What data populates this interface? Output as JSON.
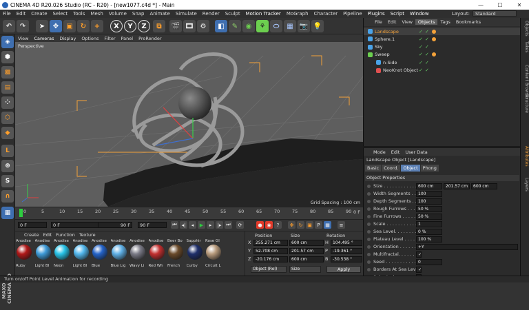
{
  "window": {
    "title": "CINEMA 4D R20.026 Studio (RC - R20) - [new1077.c4d *] - Main"
  },
  "menubar": [
    "File",
    "Edit",
    "Create",
    "Select",
    "Tools",
    "Mesh",
    "Volume",
    "Snap",
    "Animate",
    "Simulate",
    "Render",
    "Sculpt",
    "Motion Tracker",
    "MoGraph",
    "Character",
    "Pipeline",
    "Plugins",
    "Script",
    "Window"
  ],
  "layout": {
    "label": "Layout:",
    "value": "Standard"
  },
  "toolbar": {
    "axes": [
      "X",
      "Y",
      "Z"
    ]
  },
  "viewport": {
    "menu": [
      "View",
      "Cameras",
      "Display",
      "Options",
      "Filter",
      "Panel",
      "ProRender"
    ],
    "camera": "Perspective",
    "grid_spacing": "Grid Spacing : 100 cm"
  },
  "timeline": {
    "ticks": [
      "0",
      "5",
      "10",
      "15",
      "20",
      "25",
      "30",
      "35",
      "40",
      "45",
      "50",
      "55",
      "60",
      "65",
      "70",
      "75",
      "80",
      "85",
      "90"
    ],
    "frame_badge": "0 F"
  },
  "transport": {
    "start": "0 F",
    "current": "0 F",
    "end": "90 F",
    "end2": "90 F"
  },
  "materials": {
    "menu": [
      "Create",
      "Edit",
      "Function",
      "Texture"
    ],
    "items": [
      {
        "top": "Anodise",
        "bottom": "Ruby",
        "color": "#b01818"
      },
      {
        "top": "Anodise",
        "bottom": "Light Bl",
        "color": "#3f9bd8"
      },
      {
        "top": "Anodise",
        "bottom": "Neon",
        "color": "#28c3e8"
      },
      {
        "top": "Anodise",
        "bottom": "Light Bl",
        "color": "#53b8ee"
      },
      {
        "top": "Anodise",
        "bottom": "Blue",
        "color": "#2463c8"
      },
      {
        "top": "Anodise",
        "bottom": "Blue Lig",
        "color": "#5fb0e6"
      },
      {
        "top": "Anodise",
        "bottom": "Wavy Li",
        "color": "#7a7a86"
      },
      {
        "top": "Anodise",
        "bottom": "Red Wh",
        "color": "#c22f2f"
      },
      {
        "top": "Beer Bo",
        "bottom": "French",
        "color": "#6a4a2a"
      },
      {
        "top": "Sapphir",
        "bottom": "Curby",
        "color": "#1f2f6a"
      },
      {
        "top": "Rose Gl",
        "bottom": "Circuit L",
        "color": "#b79a7c"
      }
    ]
  },
  "coords": {
    "headers": [
      "Position",
      "Size",
      "Rotation"
    ],
    "rows": [
      {
        "axis": "X",
        "pos": "255.271 cm",
        "size": "600 cm",
        "rot_label": "H",
        "rot": "104.495 °"
      },
      {
        "axis": "Y",
        "pos": "52.708 cm",
        "size": "201.57 cm",
        "rot_label": "P",
        "rot": "-19.361 °"
      },
      {
        "axis": "Z",
        "pos": "-20.176 cm",
        "size": "600 cm",
        "rot_label": "B",
        "rot": "-30.538 °"
      }
    ],
    "mode1": "Object (Rel)",
    "mode2": "Size",
    "apply": "Apply"
  },
  "objects": {
    "menu": [
      "File",
      "Edit",
      "View",
      "Objects",
      "Tags",
      "Bookmarks"
    ],
    "items": [
      {
        "name": "Landscape",
        "indent": 0,
        "icon_color": "#4aa3e8",
        "selected": true,
        "tag": true
      },
      {
        "name": "Sphere.1",
        "indent": 0,
        "icon_color": "#4aa3e8",
        "selected": false,
        "tag": true
      },
      {
        "name": "Sky",
        "indent": 0,
        "icon_color": "#4aa3e8",
        "selected": false,
        "tag": false
      },
      {
        "name": "Sweep",
        "indent": 0,
        "icon_color": "#6ccf4f",
        "selected": false,
        "tag": true
      },
      {
        "name": "n-Side",
        "indent": 1,
        "icon_color": "#4aa3e8",
        "selected": false,
        "tag": false
      },
      {
        "name": "NeoKnot Object",
        "indent": 1,
        "icon_color": "#e05050",
        "selected": false,
        "tag": false
      }
    ]
  },
  "attributes": {
    "menu": [
      "Mode",
      "Edit",
      "User Data"
    ],
    "title": "Landscape Object [Landscape]",
    "tabs": [
      "Basic",
      "Coord.",
      "Object",
      "Phong"
    ],
    "section": "Object Properties",
    "props": [
      {
        "label": "Size . . . . . . . . . . . . . . .",
        "values": [
          "600 cm",
          "201.57 cm",
          "600 cm"
        ]
      },
      {
        "label": "Width Segments . . . .",
        "values": [
          "100"
        ]
      },
      {
        "label": "Depth Segments . . .",
        "values": [
          "100"
        ]
      },
      {
        "label": "Rough Furrows . . . . .",
        "values": [
          "50 %"
        ]
      },
      {
        "label": "Fine Furrows . . . . . .",
        "values": [
          "50 %"
        ]
      },
      {
        "label": "Scale . . . . . . . . . . . . .",
        "values": [
          "1"
        ]
      },
      {
        "label": "Sea Level. . . . . . . . . .",
        "values": [
          "0 %"
        ]
      },
      {
        "label": "Plateau Level . . . . . .",
        "values": [
          "100 %"
        ]
      },
      {
        "label": "Orientation . . . . . . . .",
        "values": [
          "+Y"
        ]
      },
      {
        "label": "Multifractal. . . . . . . .",
        "values": [
          "✓"
        ]
      },
      {
        "label": "Seed . . . . . . . . . . . . .",
        "values": [
          "0"
        ]
      },
      {
        "label": "Borders At Sea Level",
        "values": [
          "✓"
        ]
      },
      {
        "label": "Spherical. . . . . . . . . .",
        "values": [
          ""
        ]
      }
    ]
  },
  "sidetabs": [
    "Objects",
    "Takes",
    "Content Browser",
    "Structure",
    "Attributes",
    "Layers"
  ],
  "maxon": "MAXON CINEMA 4D",
  "status": "Turn on/off Point Level Animation for recording",
  "colors": {
    "accent": "#f4a23a",
    "selection": "#5b7fb3",
    "play": "#2ecc40",
    "record": "#e03a2a"
  }
}
